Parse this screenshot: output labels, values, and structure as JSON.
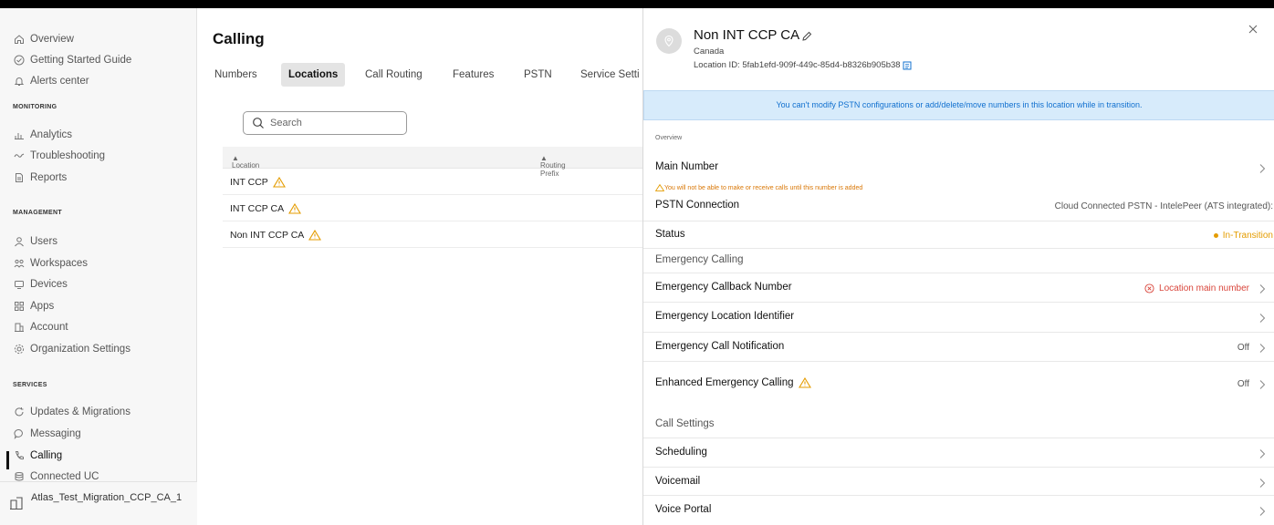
{
  "sidebar": {
    "items_top": [
      {
        "label": "Overview",
        "icon": "home-icon"
      },
      {
        "label": "Getting Started Guide",
        "icon": "check-circle-icon"
      },
      {
        "label": "Alerts center",
        "icon": "bell-icon"
      }
    ],
    "section_monitoring": "MONITORING",
    "items_monitoring": [
      {
        "label": "Analytics",
        "icon": "bar-chart-icon"
      },
      {
        "label": "Troubleshooting",
        "icon": "pulse-icon"
      },
      {
        "label": "Reports",
        "icon": "document-icon"
      }
    ],
    "section_management": "MANAGEMENT",
    "items_management": [
      {
        "label": "Users",
        "icon": "user-icon"
      },
      {
        "label": "Workspaces",
        "icon": "workspaces-icon"
      },
      {
        "label": "Devices",
        "icon": "device-icon"
      },
      {
        "label": "Apps",
        "icon": "apps-grid-icon"
      },
      {
        "label": "Account",
        "icon": "building-icon"
      },
      {
        "label": "Organization Settings",
        "icon": "gear-icon"
      }
    ],
    "section_services": "SERVICES",
    "items_services": [
      {
        "label": "Updates & Migrations",
        "icon": "refresh-icon"
      },
      {
        "label": "Messaging",
        "icon": "chat-bubble-icon"
      },
      {
        "label": "Calling",
        "icon": "phone-icon"
      },
      {
        "label": "Connected UC",
        "icon": "database-icon"
      }
    ],
    "org_name": "Atlas_Test_Migration_CCP_CA_1"
  },
  "main": {
    "title": "Calling",
    "tabs": [
      "Numbers",
      "Locations",
      "Call Routing",
      "Features",
      "PSTN",
      "Service Setti"
    ],
    "active_tab": "Locations",
    "search_placeholder": "Search",
    "columns": [
      "Location",
      "Routing Prefix"
    ],
    "rows": [
      "INT CCP",
      "INT CCP CA",
      "Non INT CCP CA"
    ]
  },
  "panel": {
    "location_name": "Non INT CCP CA",
    "country": "Canada",
    "location_id": "Location ID: 5fab1efd-909f-449c-85d4-b8326b905b38",
    "banner": "You can't modify PSTN configurations or add/delete/move numbers in this location while in transition.",
    "overview_label": "Overview",
    "main_number_label": "Main Number",
    "main_number_hint": "You will not be able to make or receive calls until this number is added",
    "pstn_label": "PSTN Connection",
    "pstn_value": "Cloud Connected PSTN - IntelePeer (ATS integrated):",
    "status_label": "Status",
    "status_value": "In-Transition",
    "emergency_section": "Emergency Calling",
    "ecbn_label": "Emergency Callback Number",
    "ecbn_value": "Location main number",
    "eli_label": "Emergency Location Identifier",
    "ecn_label": "Emergency Call Notification",
    "ecn_value": "Off",
    "eec_label": "Enhanced Emergency Calling",
    "eec_value": "Off",
    "call_settings_section": "Call Settings",
    "scheduling_label": "Scheduling",
    "voicemail_label": "Voicemail",
    "voice_portal_label": "Voice Portal"
  },
  "colors": {
    "accent_blue": "#1170cf",
    "banner_bg": "#d7ebfb",
    "warning_orange": "#e49c00",
    "error_red": "#d9453b"
  }
}
